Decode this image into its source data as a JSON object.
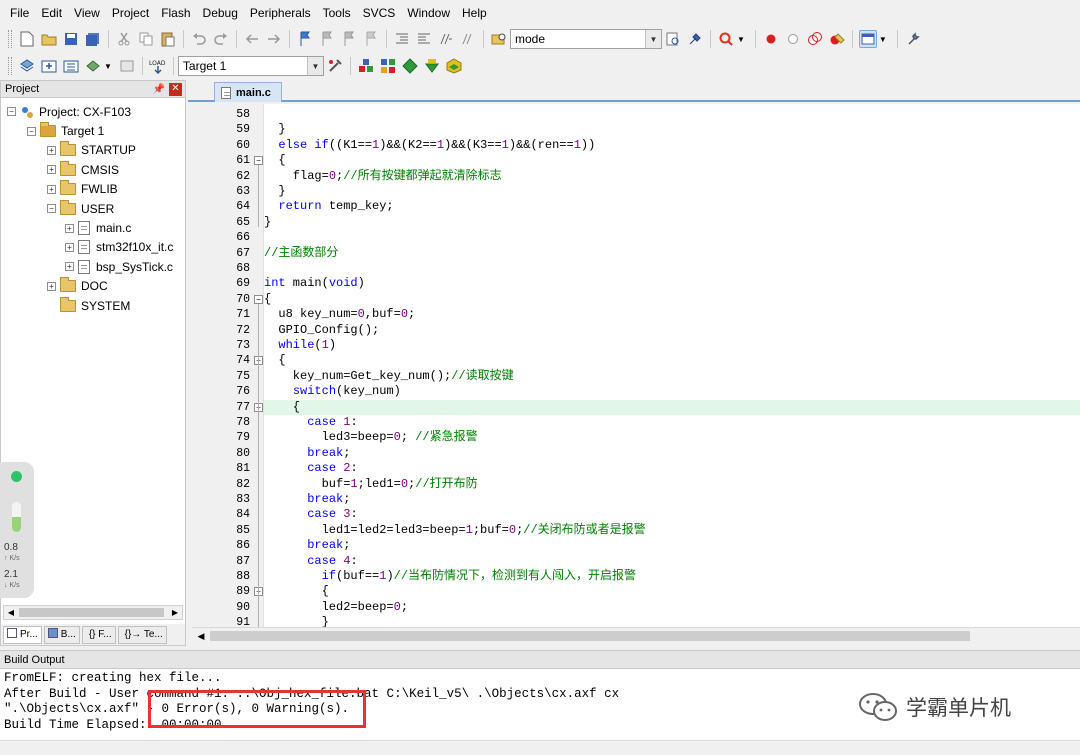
{
  "menu": [
    "File",
    "Edit",
    "View",
    "Project",
    "Flash",
    "Debug",
    "Peripherals",
    "Tools",
    "SVCS",
    "Window",
    "Help"
  ],
  "toolbar": {
    "find_combo_value": "mode",
    "target_select_value": "Target 1"
  },
  "project_panel": {
    "title": "Project",
    "tree": [
      {
        "label": "Project: CX-F103",
        "level": 0,
        "kind": "project",
        "expander": "minus"
      },
      {
        "label": "Target 1",
        "level": 1,
        "kind": "target",
        "expander": "minus"
      },
      {
        "label": "STARTUP",
        "level": 2,
        "kind": "folder",
        "expander": "plus"
      },
      {
        "label": "CMSIS",
        "level": 2,
        "kind": "folder",
        "expander": "plus"
      },
      {
        "label": "FWLIB",
        "level": 2,
        "kind": "folder",
        "expander": "plus"
      },
      {
        "label": "USER",
        "level": 2,
        "kind": "folder",
        "expander": "minus"
      },
      {
        "label": "main.c",
        "level": 3,
        "kind": "file",
        "expander": "plus"
      },
      {
        "label": "stm32f10x_it.c",
        "level": 3,
        "kind": "file",
        "expander": "plus"
      },
      {
        "label": "bsp_SysTick.c",
        "level": 3,
        "kind": "file",
        "expander": "plus"
      },
      {
        "label": "DOC",
        "level": 2,
        "kind": "folder",
        "expander": "plus"
      },
      {
        "label": "SYSTEM",
        "level": 2,
        "kind": "folder",
        "expander": "none"
      }
    ],
    "bottom_tabs": [
      "Pr...",
      "B...",
      "{} F...",
      "{}→ Te..."
    ]
  },
  "net_widget": {
    "upload": "0.8",
    "upload_unit": "K/s",
    "download": "2.1",
    "download_unit": "K/s"
  },
  "editor": {
    "active_tab": "main.c",
    "current_line": 77,
    "lines": [
      {
        "n": 58,
        "fold": "",
        "segs": [
          {
            "t": "",
            "c": "txt"
          }
        ]
      },
      {
        "n": 59,
        "fold": "",
        "segs": [
          {
            "t": "  }",
            "c": "txt"
          }
        ]
      },
      {
        "n": 60,
        "fold": "",
        "segs": [
          {
            "t": "  ",
            "c": "txt"
          },
          {
            "t": "else if",
            "c": "kw"
          },
          {
            "t": "((K1==",
            "c": "txt"
          },
          {
            "t": "1",
            "c": "num"
          },
          {
            "t": ")&&(K2==",
            "c": "txt"
          },
          {
            "t": "1",
            "c": "num"
          },
          {
            "t": ")&&(K3==",
            "c": "txt"
          },
          {
            "t": "1",
            "c": "num"
          },
          {
            "t": ")&&(ren==",
            "c": "txt"
          },
          {
            "t": "1",
            "c": "num"
          },
          {
            "t": "))",
            "c": "txt"
          }
        ]
      },
      {
        "n": 61,
        "fold": "minus",
        "segs": [
          {
            "t": "  {",
            "c": "txt"
          }
        ]
      },
      {
        "n": 62,
        "fold": "",
        "segs": [
          {
            "t": "    flag=",
            "c": "txt"
          },
          {
            "t": "0",
            "c": "num"
          },
          {
            "t": ";",
            "c": "txt"
          },
          {
            "t": "//所有按键都弹起就清除标志",
            "c": "cmt"
          }
        ]
      },
      {
        "n": 63,
        "fold": "",
        "segs": [
          {
            "t": "  }",
            "c": "txt"
          }
        ]
      },
      {
        "n": 64,
        "fold": "",
        "segs": [
          {
            "t": "  ",
            "c": "txt"
          },
          {
            "t": "return",
            "c": "kw"
          },
          {
            "t": " temp_key;",
            "c": "txt"
          }
        ]
      },
      {
        "n": 65,
        "fold": "",
        "segs": [
          {
            "t": "}",
            "c": "txt"
          }
        ]
      },
      {
        "n": 66,
        "fold": "",
        "segs": [
          {
            "t": "",
            "c": "txt"
          }
        ]
      },
      {
        "n": 67,
        "fold": "",
        "segs": [
          {
            "t": "//主函数部分",
            "c": "cmt"
          }
        ]
      },
      {
        "n": 68,
        "fold": "",
        "segs": [
          {
            "t": "",
            "c": "txt"
          }
        ]
      },
      {
        "n": 69,
        "fold": "",
        "segs": [
          {
            "t": "int",
            "c": "kw"
          },
          {
            "t": " main(",
            "c": "txt"
          },
          {
            "t": "void",
            "c": "kw"
          },
          {
            "t": ")",
            "c": "txt"
          }
        ]
      },
      {
        "n": 70,
        "fold": "minus",
        "segs": [
          {
            "t": "{",
            "c": "txt"
          }
        ]
      },
      {
        "n": 71,
        "fold": "",
        "segs": [
          {
            "t": "  u8 key_num=",
            "c": "txt"
          },
          {
            "t": "0",
            "c": "num"
          },
          {
            "t": ",buf=",
            "c": "txt"
          },
          {
            "t": "0",
            "c": "num"
          },
          {
            "t": ";",
            "c": "txt"
          }
        ]
      },
      {
        "n": 72,
        "fold": "",
        "segs": [
          {
            "t": "  GPIO_Config();",
            "c": "txt"
          }
        ]
      },
      {
        "n": 73,
        "fold": "",
        "segs": [
          {
            "t": "  ",
            "c": "txt"
          },
          {
            "t": "while",
            "c": "kw"
          },
          {
            "t": "(",
            "c": "txt"
          },
          {
            "t": "1",
            "c": "num"
          },
          {
            "t": ")",
            "c": "txt"
          }
        ]
      },
      {
        "n": 74,
        "fold": "minus",
        "segs": [
          {
            "t": "  {",
            "c": "txt"
          }
        ]
      },
      {
        "n": 75,
        "fold": "",
        "segs": [
          {
            "t": "    key_num=Get_key_num();",
            "c": "txt"
          },
          {
            "t": "//读取按键",
            "c": "cmt"
          }
        ]
      },
      {
        "n": 76,
        "fold": "",
        "segs": [
          {
            "t": "    ",
            "c": "txt"
          },
          {
            "t": "switch",
            "c": "kw"
          },
          {
            "t": "(key_num)",
            "c": "txt"
          }
        ]
      },
      {
        "n": 77,
        "fold": "minus",
        "segs": [
          {
            "t": "    {",
            "c": "txt"
          }
        ]
      },
      {
        "n": 78,
        "fold": "",
        "segs": [
          {
            "t": "      ",
            "c": "txt"
          },
          {
            "t": "case",
            "c": "kw"
          },
          {
            "t": " ",
            "c": "txt"
          },
          {
            "t": "1",
            "c": "num"
          },
          {
            "t": ":",
            "c": "txt"
          }
        ]
      },
      {
        "n": 79,
        "fold": "",
        "segs": [
          {
            "t": "        led3=beep=",
            "c": "txt"
          },
          {
            "t": "0",
            "c": "num"
          },
          {
            "t": "; ",
            "c": "txt"
          },
          {
            "t": "//紧急报警",
            "c": "cmt"
          }
        ]
      },
      {
        "n": 80,
        "fold": "",
        "segs": [
          {
            "t": "      ",
            "c": "txt"
          },
          {
            "t": "break",
            "c": "kw"
          },
          {
            "t": ";",
            "c": "txt"
          }
        ]
      },
      {
        "n": 81,
        "fold": "",
        "segs": [
          {
            "t": "      ",
            "c": "txt"
          },
          {
            "t": "case",
            "c": "kw"
          },
          {
            "t": " ",
            "c": "txt"
          },
          {
            "t": "2",
            "c": "num"
          },
          {
            "t": ":",
            "c": "txt"
          }
        ]
      },
      {
        "n": 82,
        "fold": "",
        "segs": [
          {
            "t": "        buf=",
            "c": "txt"
          },
          {
            "t": "1",
            "c": "num"
          },
          {
            "t": ";led1=",
            "c": "txt"
          },
          {
            "t": "0",
            "c": "num"
          },
          {
            "t": ";",
            "c": "txt"
          },
          {
            "t": "//打开布防",
            "c": "cmt"
          }
        ]
      },
      {
        "n": 83,
        "fold": "",
        "segs": [
          {
            "t": "      ",
            "c": "txt"
          },
          {
            "t": "break",
            "c": "kw"
          },
          {
            "t": ";",
            "c": "txt"
          }
        ]
      },
      {
        "n": 84,
        "fold": "",
        "segs": [
          {
            "t": "      ",
            "c": "txt"
          },
          {
            "t": "case",
            "c": "kw"
          },
          {
            "t": " ",
            "c": "txt"
          },
          {
            "t": "3",
            "c": "num"
          },
          {
            "t": ":",
            "c": "txt"
          }
        ]
      },
      {
        "n": 85,
        "fold": "",
        "segs": [
          {
            "t": "        led1=led2=led3=beep=",
            "c": "txt"
          },
          {
            "t": "1",
            "c": "num"
          },
          {
            "t": ";buf=",
            "c": "txt"
          },
          {
            "t": "0",
            "c": "num"
          },
          {
            "t": ";",
            "c": "txt"
          },
          {
            "t": "//关闭布防或者是报警",
            "c": "cmt"
          }
        ]
      },
      {
        "n": 86,
        "fold": "",
        "segs": [
          {
            "t": "      ",
            "c": "txt"
          },
          {
            "t": "break",
            "c": "kw"
          },
          {
            "t": ";",
            "c": "txt"
          }
        ]
      },
      {
        "n": 87,
        "fold": "",
        "segs": [
          {
            "t": "      ",
            "c": "txt"
          },
          {
            "t": "case",
            "c": "kw"
          },
          {
            "t": " ",
            "c": "txt"
          },
          {
            "t": "4",
            "c": "num"
          },
          {
            "t": ":",
            "c": "txt"
          }
        ]
      },
      {
        "n": 88,
        "fold": "",
        "segs": [
          {
            "t": "        ",
            "c": "txt"
          },
          {
            "t": "if",
            "c": "kw"
          },
          {
            "t": "(buf==",
            "c": "txt"
          },
          {
            "t": "1",
            "c": "num"
          },
          {
            "t": ")",
            "c": "txt"
          },
          {
            "t": "//当布防情况下，检测到有人闯入，开启报警",
            "c": "cmt"
          }
        ]
      },
      {
        "n": 89,
        "fold": "minus",
        "segs": [
          {
            "t": "        {",
            "c": "txt"
          }
        ]
      },
      {
        "n": 90,
        "fold": "",
        "segs": [
          {
            "t": "        led2=beep=",
            "c": "txt"
          },
          {
            "t": "0",
            "c": "num"
          },
          {
            "t": ";",
            "c": "txt"
          }
        ]
      },
      {
        "n": 91,
        "fold": "",
        "segs": [
          {
            "t": "        }",
            "c": "txt"
          }
        ]
      }
    ]
  },
  "build_output": {
    "title": "Build Output",
    "lines": [
      "FromELF: creating hex file...",
      "After Build - User command #1: ..\\Obj_hex_file.bat C:\\Keil_v5\\ .\\Objects\\cx.axf cx",
      "\".\\Objects\\cx.axf\" - 0 Error(s), 0 Warning(s).",
      "Build Time Elapsed:  00:00:00"
    ]
  },
  "watermark": {
    "text": "学霸单片机"
  },
  "colors": {
    "keyword": "#0000ff",
    "number": "#800080",
    "comment": "#008000",
    "current_line": "#e2f7e8",
    "highlight_box": "#e63333"
  }
}
